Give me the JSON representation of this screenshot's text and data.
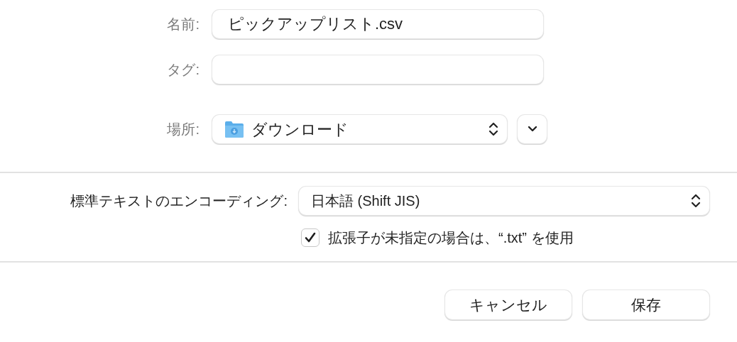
{
  "fields": [
    {
      "kind": "text",
      "label": "名前:",
      "value": "ピックアップリスト.csv"
    },
    {
      "kind": "text",
      "label": "タグ:"
    },
    {
      "kind": "popup",
      "label": "場所:",
      "value": "ダウンロード"
    }
  ],
  "encoding": {
    "label": "標準テキストのエンコーディング:",
    "value": "日本語 (Shift JIS)"
  },
  "checkbox": {
    "label": "拡張子が未指定の場合は、“.txt” を使用",
    "checked": true
  },
  "buttons": [
    {
      "label": "キャンセル"
    },
    {
      "label": "保存"
    }
  ]
}
